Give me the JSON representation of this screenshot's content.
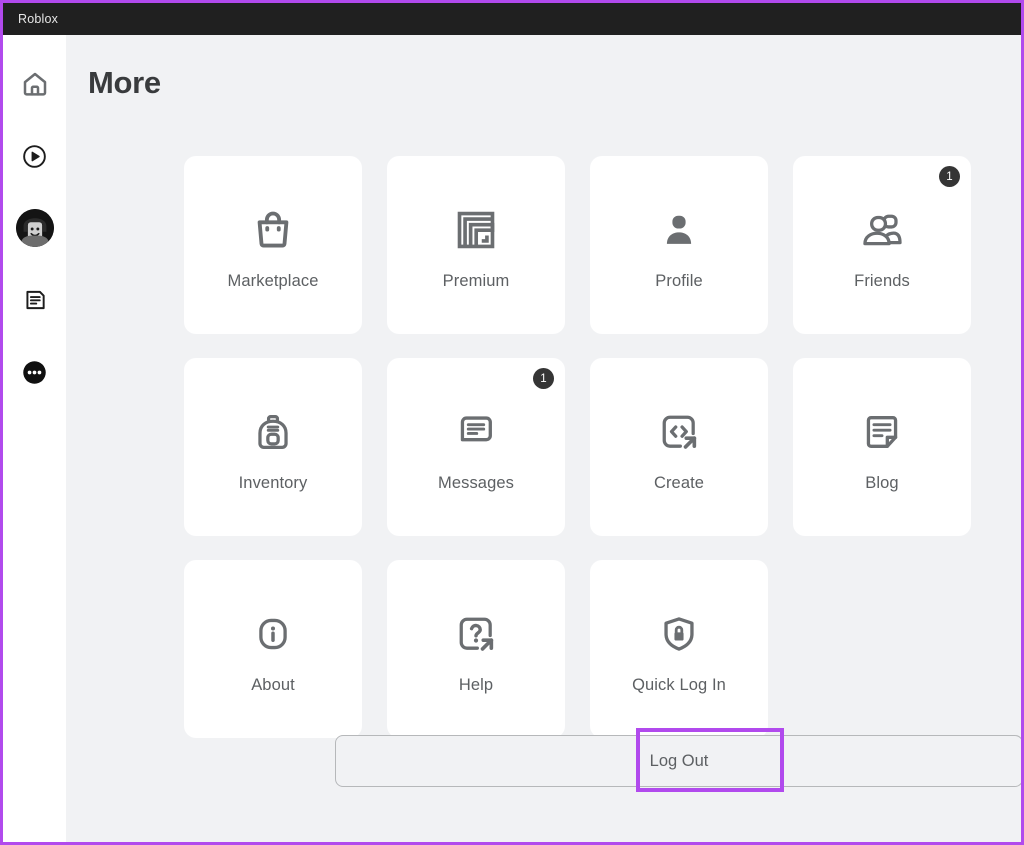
{
  "window": {
    "title": "Roblox",
    "accent_color": "#b14aed",
    "titlebar_color": "#202020",
    "content_bg": "#f1f2f4",
    "card_bg": "#ffffff"
  },
  "sidebar": {
    "items": [
      {
        "name": "home",
        "icon": "home-icon"
      },
      {
        "name": "discover",
        "icon": "play-circle-icon"
      },
      {
        "name": "avatar",
        "icon": "avatar-icon"
      },
      {
        "name": "chat",
        "icon": "chat-document-icon"
      },
      {
        "name": "more",
        "icon": "ellipsis-filled-icon"
      }
    ]
  },
  "main": {
    "title": "More",
    "cards": [
      {
        "label": "Marketplace",
        "icon": "shopping-bag-icon",
        "badge": ""
      },
      {
        "label": "Premium",
        "icon": "premium-spiral-icon",
        "badge": ""
      },
      {
        "label": "Profile",
        "icon": "person-filled-icon",
        "badge": ""
      },
      {
        "label": "Friends",
        "icon": "people-group-icon",
        "badge": "1"
      },
      {
        "label": "Inventory",
        "icon": "backpack-icon",
        "badge": ""
      },
      {
        "label": "Messages",
        "icon": "message-icon",
        "badge": "1"
      },
      {
        "label": "Create",
        "icon": "code-external-icon",
        "badge": ""
      },
      {
        "label": "Blog",
        "icon": "blog-document-icon",
        "badge": ""
      },
      {
        "label": "About",
        "icon": "info-icon",
        "badge": ""
      },
      {
        "label": "Help",
        "icon": "question-external-icon",
        "badge": ""
      },
      {
        "label": "Quick Log In",
        "icon": "shield-lock-icon",
        "badge": ""
      }
    ],
    "logout_label": "Log Out"
  }
}
